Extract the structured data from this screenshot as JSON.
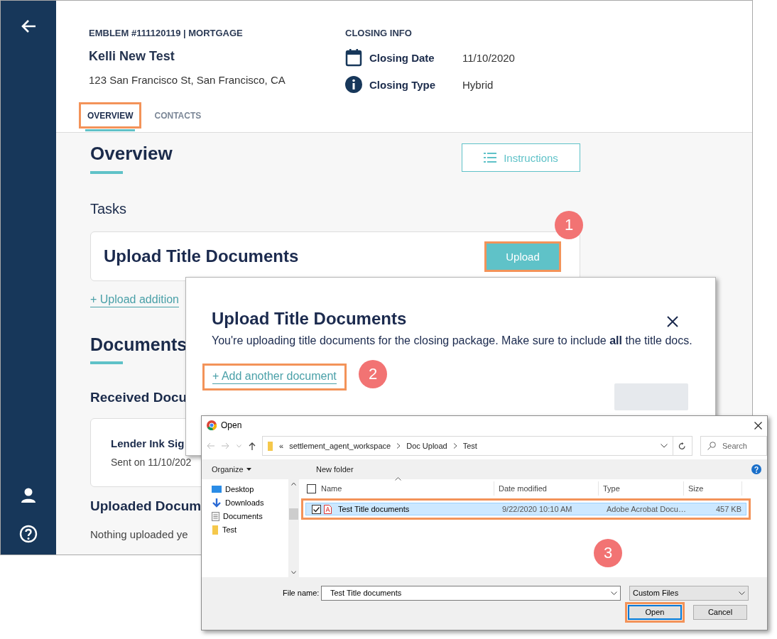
{
  "app": {
    "header": {
      "loan_label": "EMBLEM #111120119 | MORTGAGE",
      "borrower": "Kelli New Test",
      "address": "123 San Francisco St, San Francisco, CA",
      "closing_info": {
        "title": "CLOSING INFO",
        "rows": [
          {
            "kind": "date",
            "label": "Closing Date",
            "value": "11/10/2020"
          },
          {
            "kind": "info",
            "label": "Closing Type",
            "value": "Hybrid"
          }
        ]
      }
    },
    "tabs": [
      {
        "label": "OVERVIEW",
        "selected": true,
        "highlighted": true
      },
      {
        "label": "CONTACTS",
        "selected": false,
        "highlighted": false
      }
    ],
    "overview": {
      "title": "Overview",
      "instructions_button": "Instructions",
      "tasks_heading": "Tasks",
      "task": {
        "title": "Upload Title Documents",
        "button": "Upload",
        "highlighted": true
      },
      "upload_link": "+ Upload addition",
      "documents_title": "Documents",
      "received_heading": "Received Docu",
      "received_doc": {
        "name": "Lender Ink Sig",
        "sent": "Sent on 11/10/202"
      },
      "uploaded_heading": "Uploaded Docum",
      "uploaded_empty": "Nothing uploaded ye"
    }
  },
  "upload_modal": {
    "title": "Upload Title Documents",
    "description": "You're uploading title documents for the closing package. Make sure to include **all** the title docs.",
    "add_link": {
      "label": "+ Add another document",
      "highlighted": true
    },
    "upload_button": {
      "disabled": true
    }
  },
  "open_dialog": {
    "title": "Open",
    "path": {
      "overflow": "«",
      "crumbs": [
        "settlement_agent_workspace",
        "Doc Upload",
        "Test"
      ]
    },
    "search_placeholder": "Search",
    "toolbar": [
      "Organize",
      "New folder"
    ],
    "nav_items": [
      {
        "kind": "desktop",
        "label": "Desktop"
      },
      {
        "kind": "downloads",
        "label": "Downloads"
      },
      {
        "kind": "documents",
        "label": "Documents"
      },
      {
        "kind": "folder",
        "label": "Test"
      }
    ],
    "columns": [
      "Name",
      "Date modified",
      "Type",
      "Size"
    ],
    "select_all_checked": false,
    "files": [
      {
        "name": "Test Title documents",
        "date": "9/22/2020 10:10 AM",
        "type": "Adobe Acrobat Docu…",
        "size": "457 KB",
        "selected": true,
        "checked": true,
        "highlighted": true
      }
    ],
    "file_name_label": "File name:",
    "file_name": "Test Title documents",
    "file_type": "Custom Files",
    "buttons": [
      {
        "label": "Open",
        "default": true,
        "highlighted": true
      },
      {
        "label": "Cancel",
        "default": false,
        "highlighted": false
      }
    ]
  },
  "callouts": [
    {
      "label": "1"
    },
    {
      "label": "2"
    },
    {
      "label": "3"
    }
  ]
}
